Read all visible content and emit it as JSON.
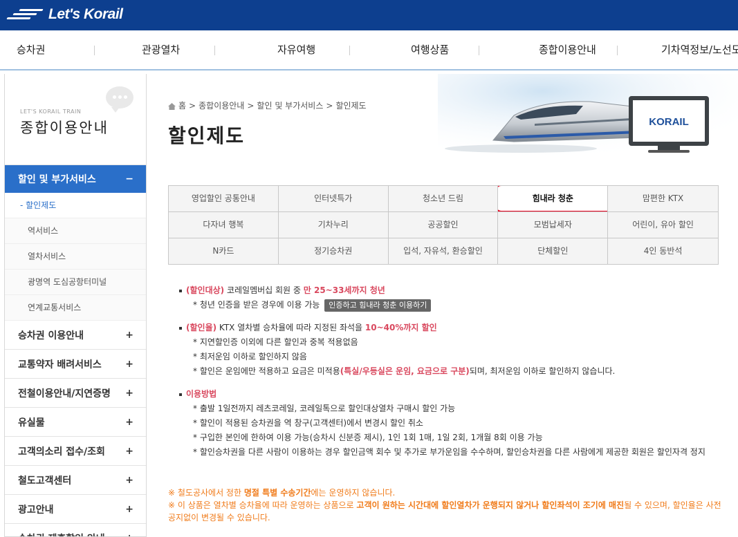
{
  "brand": {
    "logo_text": "Let's Korail"
  },
  "nav": {
    "items": [
      "승차권",
      "관광열차",
      "자유여행",
      "여행상품",
      "종합이용안내",
      "기차역정보/노선도"
    ]
  },
  "sidebar": {
    "sub": "LET'S KORAIL TRAIN",
    "title": "종합이용안내",
    "active_label": "할인 및 부가서비스",
    "active_toggle": "−",
    "subitems": [
      "- 할인제도",
      "역서비스",
      "열차서비스",
      "광명역 도심공항터미널",
      "연계교통서비스"
    ],
    "categories": [
      {
        "label": "승차권 이용안내",
        "toggle": "+"
      },
      {
        "label": "교통약자 배려서비스",
        "toggle": "+"
      },
      {
        "label": "전철이용안내/지연증명",
        "toggle": "+"
      },
      {
        "label": "유실물",
        "toggle": "+"
      },
      {
        "label": "고객의소리 접수/조회",
        "toggle": "+"
      },
      {
        "label": "철도고객센터",
        "toggle": "+"
      },
      {
        "label": "광고안내",
        "toggle": "+"
      },
      {
        "label": "승차권 제휴할인 안내",
        "toggle": "+"
      }
    ]
  },
  "breadcrumb": {
    "home": "홈",
    "sep": ">",
    "items": [
      "종합이용안내",
      "할인 및 부가서비스",
      "할인제도"
    ]
  },
  "page_title": "할인제도",
  "banner": {
    "logo_text": "KORAIL"
  },
  "tabs": [
    [
      "영업할인 공통안내",
      "인터넷특가",
      "청소년 드림",
      "힘내라 청춘",
      "맘편한 KTX"
    ],
    [
      "다자녀 행복",
      "기차누리",
      "공공할인",
      "모범납세자",
      "어린이, 유아 할인"
    ],
    [
      "N카드",
      "정기승차권",
      "입석, 자유석, 환승할인",
      "단체할인",
      "4인 동반석"
    ]
  ],
  "content": {
    "target": {
      "label": "(할인대상)",
      "text": " 코레일멤버십 회원 중 ",
      "highlight": "만 25~33세까지 청년",
      "note": "* 청년 인증을 받은 경우에 이용 가능",
      "tooltip": "인증하고 힘내라 청춘 이용하기"
    },
    "rate": {
      "label": "(할인율)",
      "text": " KTX 열차별 승차율에 따라 지정된 좌석을 ",
      "highlight": "10~40%까지 할인",
      "notes": [
        "* 지연할인증 이외에 다른 할인과 중복 적용없음",
        "* 최저운임 이하로 할인하지 않음"
      ],
      "note3_pre": "* 할인은 운임에만 적용하고 요금은 미적용",
      "note3_hl": "(특실/우등실은 운임, 요금으로 구분)",
      "note3_post": "되며, 최저운임 이하로 할인하지 않습니다."
    },
    "usage": {
      "label": "이용방법",
      "notes": [
        "* 출발 1일전까지 레츠코레일, 코레일톡으로 할인대상열차 구매시 할인 가능",
        "* 할인이 적용된 승차권을 역 창구(고객센터)에서 변경시 할인 취소",
        "* 구입한 본인에 한하여 이용 가능(승차시 신분증 제시), 1인 1회 1매, 1일 2회, 1개월 8회 이용 가능",
        "* 할인승차권을 다른 사람이 이용하는 경우 할인금액 회수 및 추가로 부가운임을 수수하며, 할인승차권을 다른 사람에게 제공한 회원은 할인자격 정지"
      ]
    },
    "warn1_pre": "※ 철도공사에서 정한 ",
    "warn1_hl": "명절 특별 수송기간",
    "warn1_post": "에는 운영하지 않습니다.",
    "warn2_pre": "※ 이 상품은 열차별 승차율에 따라 운영하는 상품으로 ",
    "warn2_hl": "고객이 원하는 시간대에 할인열차가 운행되지 않거나 할인좌석이 조기에 매진",
    "warn2_post": "될 수 있으며, 할인율은 사전 공지없이 변경될 수 있습니다."
  }
}
